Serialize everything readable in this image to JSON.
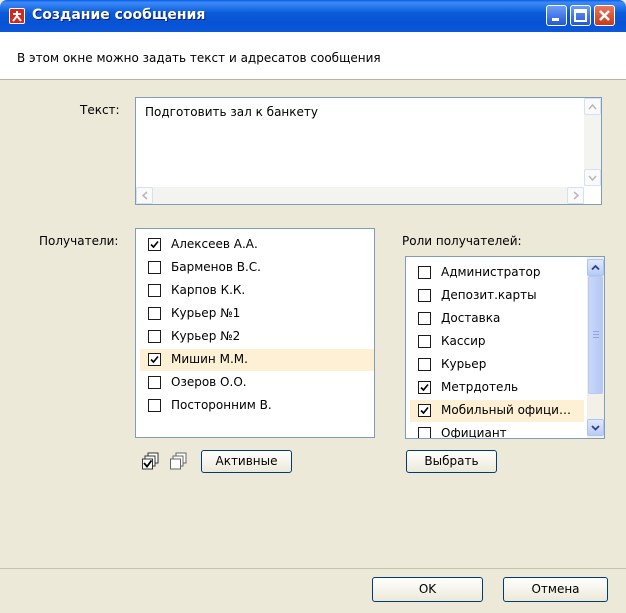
{
  "window": {
    "title": "Создание сообщения"
  },
  "intro": {
    "text": "В этом окне можно задать текст и адресатов сообщения"
  },
  "text_section": {
    "label": "Текст:",
    "value": "Подготовить зал к банкету"
  },
  "recipients": {
    "label": "Получатели:",
    "items": [
      {
        "name": "Алексеев А.А.",
        "checked": true
      },
      {
        "name": "Барменов В.С.",
        "checked": false
      },
      {
        "name": "Карпов К.К.",
        "checked": false
      },
      {
        "name": "Курьер №1",
        "checked": false
      },
      {
        "name": "Курьер №2",
        "checked": false
      },
      {
        "name": "Мишин М.М.",
        "checked": true,
        "selected": true
      },
      {
        "name": "Озеров О.О.",
        "checked": false
      },
      {
        "name": "Посторонним В.",
        "checked": false
      }
    ],
    "active_button": "Активные",
    "check_all_icon": "check-all-icon",
    "uncheck_all_icon": "uncheck-all-icon"
  },
  "roles": {
    "label": "Роли получателей:",
    "items": [
      {
        "name": "Администратор",
        "checked": false
      },
      {
        "name": "Депозит.карты",
        "checked": false
      },
      {
        "name": "Доставка",
        "checked": false
      },
      {
        "name": "Кассир",
        "checked": false
      },
      {
        "name": "Курьер",
        "checked": false
      },
      {
        "name": "Метрдотель",
        "checked": true
      },
      {
        "name": "Мобильный офици…",
        "checked": true,
        "selected": true
      },
      {
        "name": "Официант",
        "checked": false
      }
    ],
    "select_button": "Выбрать"
  },
  "footer": {
    "ok_label": "OK",
    "cancel_label": "Отмена"
  },
  "colors": {
    "titlebar": "#0a5cdb",
    "dialog_bg": "#ece9d8",
    "selection": "#fdf0d5",
    "close_button": "#c53a1c"
  }
}
